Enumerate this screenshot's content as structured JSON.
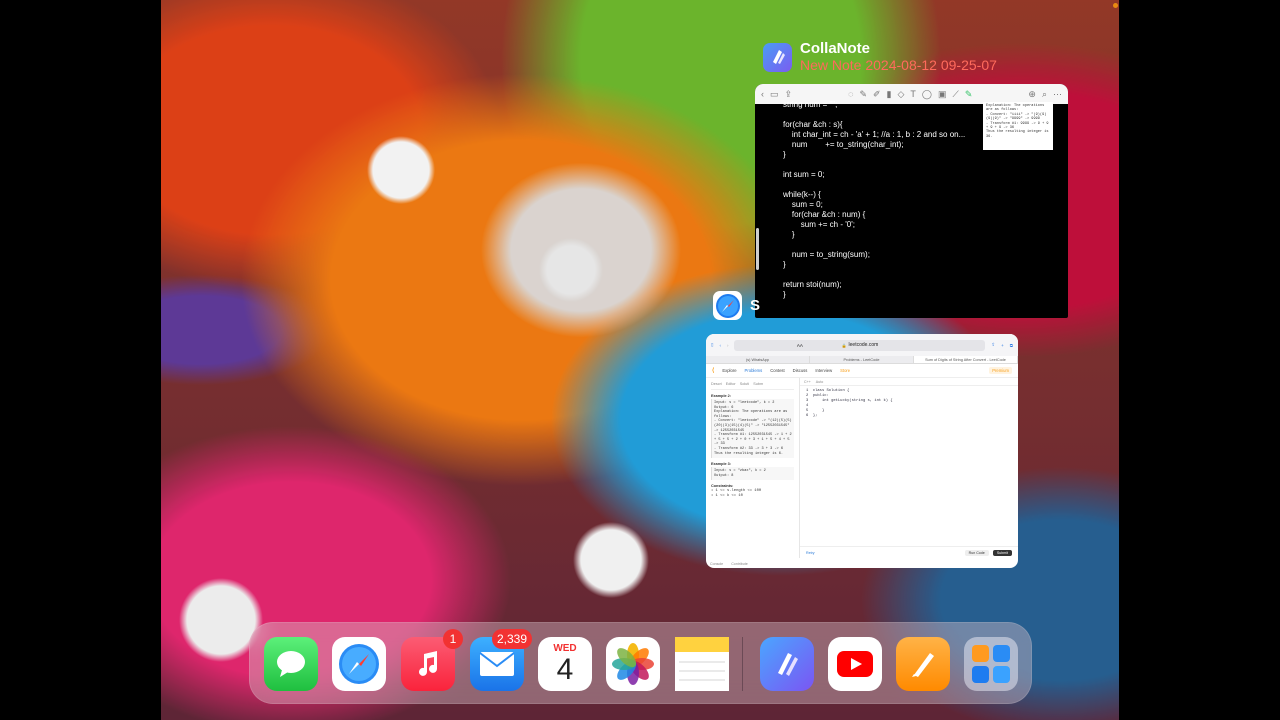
{
  "status": {
    "indicator_color": "#e88a12"
  },
  "collanote_window": {
    "app_name": "CollaNote",
    "note_title": "New Note 2024-08-12 09-25-07",
    "code_lines": [
      "string num = \"\";",
      "",
      "for(char &ch : s){",
      "    int char_int = ch - 'a' + 1; //a : 1, b : 2 and so on...",
      "    num        += to_string(char_int);",
      "}",
      "",
      "int sum = 0;",
      "",
      "while(k--) {",
      "    sum = 0;",
      "    for(char &ch : num) {",
      "        sum += ch - '0';",
      "    }",
      "",
      "    num = to_string(sum);",
      "}",
      "",
      "return stoi(num);",
      "}"
    ],
    "popup_lines": [
      "Explanation: The operations are as follows:",
      "- Convert: \"iiii\" -> \"(9)(9)(9)(9)\" -> \"9999\" -> 9999",
      "- Transform #1: 9999 -> 9 + 9 + 9 + 9 -> 36",
      "Thus the resulting integer is 36."
    ]
  },
  "safari_window": {
    "app_initial": "S",
    "url": "leetcode.com",
    "text_size": "AA",
    "tabs": [
      {
        "label": "(s) WhatsApp",
        "active": false
      },
      {
        "label": "Problems - LeetCode",
        "active": false
      },
      {
        "label": "Sum of Digits of String After Convert - LeetCode",
        "active": true
      }
    ],
    "nav": [
      "Explore",
      "Problems",
      "Contest",
      "Discuss",
      "Interview",
      "Store"
    ],
    "nav_active": "Problems",
    "premium": "Premium",
    "left_tabs": [
      "Descri",
      "Editor",
      "Soluti",
      "Subm"
    ],
    "examples": [
      {
        "title": "Example 2:",
        "body": "Input: s = \"leetcode\", k = 2\nOutput: 6\nExplanation: The operations are as follows:\n- Convert: \"leetcode\" -> \"(12)(5)(5)(20)(3)(15)(4)(5)\" -> \"12552031545\" -> 12552031545\n- Transform #1: 12552031545 -> 1 + 2 + 5 + 5 + 2 + 0 + 3 + 1 + 5 + 4 + 5 -> 33\n- Transform #2: 33 -> 3 + 3 -> 6\nThus the resulting integer is 6."
      },
      {
        "title": "Example 3:",
        "body": "Input: s = \"zbax\", k = 2\nOutput: 8"
      }
    ],
    "constraints_title": "Constraints:",
    "constraints": [
      "1 <= s.length <= 100",
      "1 <= k <= 10"
    ],
    "editor_lang": "C++",
    "editor_mode": "Auto",
    "editor_lines": [
      "1  class Solution {",
      "2  public:",
      "3      int getLucky(string s, int k) {",
      "4  ",
      "5      }",
      "6  };"
    ],
    "bottom_left": [
      "Console",
      "Contribute"
    ],
    "run_label": "Run Code",
    "submit_label": "Submit",
    "retry_label": "Retry"
  },
  "dock": {
    "apps": [
      {
        "name": "Messages",
        "icon": "messages-icon",
        "color": "#34c759"
      },
      {
        "name": "Safari",
        "icon": "safari-icon",
        "color": "#1e7cf0"
      },
      {
        "name": "Music",
        "icon": "music-icon",
        "color": "#f2334f",
        "badge": "1"
      },
      {
        "name": "Mail",
        "icon": "mail-icon",
        "color": "#2a8cf5",
        "badge": "2,339"
      },
      {
        "name": "Calendar",
        "icon": "calendar-icon",
        "day_name": "WED",
        "day_number": "4"
      },
      {
        "name": "Photos",
        "icon": "photos-icon"
      },
      {
        "name": "Notes",
        "icon": "notes-icon",
        "color": "#ffd23f"
      },
      {
        "name": "CollaNote",
        "icon": "collanote-icon",
        "color": "#6a5cf0"
      },
      {
        "name": "YouTube",
        "icon": "youtube-icon",
        "color": "#ff0000"
      },
      {
        "name": "Pages",
        "icon": "pages-icon",
        "color": "#ff9a1f"
      },
      {
        "name": "App Library",
        "icon": "app-library-icon"
      }
    ]
  }
}
